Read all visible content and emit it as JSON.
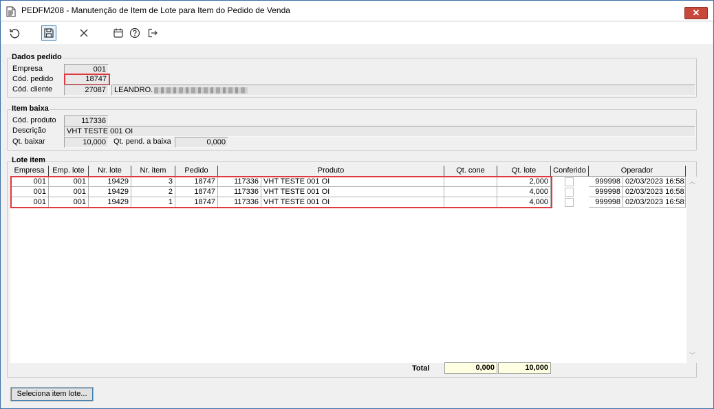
{
  "window": {
    "title": "PEDFM208 - Manutenção de Item de Lote para Item do Pedido de Venda",
    "close_symbol": "✕"
  },
  "toolbar": {
    "buttons": [
      "refresh-icon",
      "save-icon",
      "cancel-icon",
      "calendar-icon",
      "help-icon",
      "exit-icon"
    ]
  },
  "dados_pedido": {
    "legend": "Dados pedido",
    "empresa_label": "Empresa",
    "empresa_value": "001",
    "cod_pedido_label": "Cód. pedido",
    "cod_pedido_value": "18747",
    "cod_cliente_label": "Cód. cliente",
    "cod_cliente_value": "27087",
    "cliente_nome": "LEANDRO."
  },
  "item_baixa": {
    "legend": "Item baixa",
    "cod_produto_label": "Cód. produto",
    "cod_produto_value": "117336",
    "descricao_label": "Descrição",
    "descricao_value": "VHT TESTE 001 OI",
    "qt_baixar_label": "Qt. baixar",
    "qt_baixar_value": "10,000",
    "qt_pend_label": "Qt. pend. a baixa",
    "qt_pend_value": "0,000"
  },
  "lote_item": {
    "legend": "Lote item",
    "columns": [
      "Empresa",
      "Emp. lote",
      "Nr. lote",
      "Nr. item",
      "Pedido",
      "Produto",
      "Qt. cone",
      "Qt. lote",
      "Conferido",
      "Operador"
    ],
    "rows": [
      {
        "empresa": "001",
        "emp_lote": "001",
        "nr_lote": "19429",
        "nr_item": "3",
        "pedido": "18747",
        "cod_produto": "117336",
        "produto": "VHT TESTE 001 OI",
        "qt_cone": "",
        "qt_lote": "2,000",
        "operador_cod": "999998",
        "operador_data": "02/03/2023 16:58:"
      },
      {
        "empresa": "001",
        "emp_lote": "001",
        "nr_lote": "19429",
        "nr_item": "2",
        "pedido": "18747",
        "cod_produto": "117336",
        "produto": "VHT TESTE 001 OI",
        "qt_cone": "",
        "qt_lote": "4,000",
        "operador_cod": "999998",
        "operador_data": "02/03/2023 16:58:"
      },
      {
        "empresa": "001",
        "emp_lote": "001",
        "nr_lote": "19429",
        "nr_item": "1",
        "pedido": "18747",
        "cod_produto": "117336",
        "produto": "VHT TESTE 001 OI",
        "qt_cone": "",
        "qt_lote": "4,000",
        "operador_cod": "999998",
        "operador_data": "02/03/2023 16:58:"
      }
    ],
    "total_label": "Total",
    "total_qt_cone": "0,000",
    "total_qt_lote": "10,000"
  },
  "actions": {
    "seleciona_label": "Seleciona item lote..."
  }
}
